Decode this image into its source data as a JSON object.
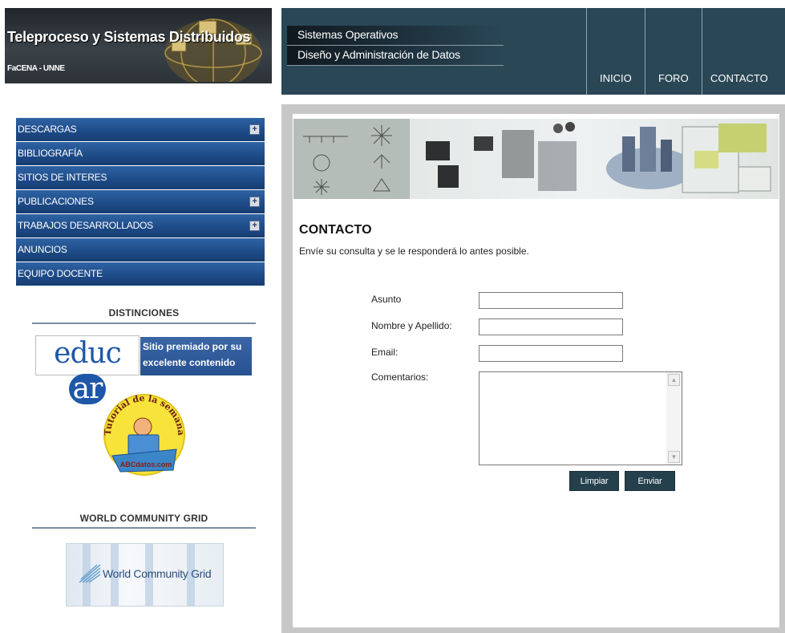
{
  "header": {
    "title": "Teleproceso y Sistemas Distribuidos",
    "subtitle": "FaCENA - UNNE"
  },
  "sidebar": {
    "items": [
      {
        "label": "DESCARGAS",
        "expandable": true
      },
      {
        "label": "BIBLIOGRAFÍA",
        "expandable": false
      },
      {
        "label": "SITIOS DE INTERES",
        "expandable": false
      },
      {
        "label": "PUBLICACIONES",
        "expandable": true
      },
      {
        "label": "TRABAJOS DESARROLLADOS",
        "expandable": true
      },
      {
        "label": "ANUNCIOS",
        "expandable": false
      },
      {
        "label": "EQUIPO DOCENTE",
        "expandable": false
      }
    ],
    "expand_symbol": "+",
    "distinctions_heading": "DISTINCIONES",
    "educar_logo": "educ",
    "educar_logo_ar": "ar",
    "educar_award": "Sitio premiado por su excelente contenido",
    "tutorial_badge_top": "Tutorial de la semana",
    "tutorial_badge_bottom": "ABCdatos.com",
    "wcg_heading": "WORLD COMMUNITY GRID",
    "wcg_logo": "World Community Grid"
  },
  "topnav": {
    "sub_links": [
      "Sistemas Operativos",
      "Diseño y Administración de Datos"
    ],
    "items": [
      "INICIO",
      "FORO",
      "CONTACTO"
    ]
  },
  "content": {
    "title": "CONTACTO",
    "intro": "Envíe su consulta y se le responderá lo antes posible."
  },
  "form": {
    "subject_label": "Asunto",
    "name_label": "Nombre y Apellido:",
    "email_label": "Email:",
    "comments_label": "Comentarios:",
    "clear_button": "Limpiar",
    "send_button": "Enviar"
  },
  "colors": {
    "topbar": "#2a4756",
    "menu_blue": "#1d4a86",
    "button_dark": "#24404d"
  }
}
